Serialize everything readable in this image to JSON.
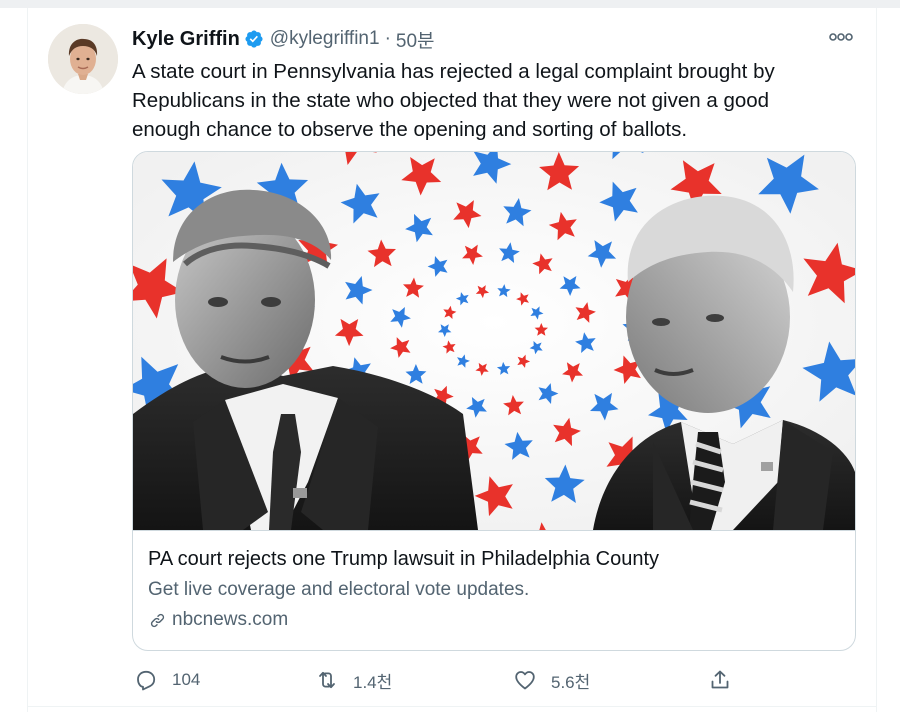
{
  "tweet": {
    "author": {
      "display_name": "Kyle Griffin",
      "handle": "@kylegriffin1",
      "verified": true
    },
    "separator": "·",
    "timestamp": "50분",
    "text": "A state court in Pennsylvania has rejected a legal complaint brought by Republicans in the state who objected that they were not given a good enough chance to observe the opening and sorting of ballots.",
    "card": {
      "title": "PA court rejects one Trump lawsuit in Philadelphia County",
      "description": "Get live coverage and electoral vote updates.",
      "domain": "nbcnews.com"
    },
    "actions": {
      "reply_count": "104",
      "retweet_count": "1.4천",
      "like_count": "5.6천"
    }
  },
  "colors": {
    "text_primary": "#0f1419",
    "text_secondary": "#536471",
    "verified_blue": "#1d9bf0",
    "border": "#cfd9de",
    "star_red": "#e8322b",
    "star_blue": "#2f7fe0"
  },
  "icons": [
    "verified-badge-icon",
    "more-options-icon",
    "link-icon",
    "reply-icon",
    "retweet-icon",
    "like-icon",
    "share-icon"
  ]
}
